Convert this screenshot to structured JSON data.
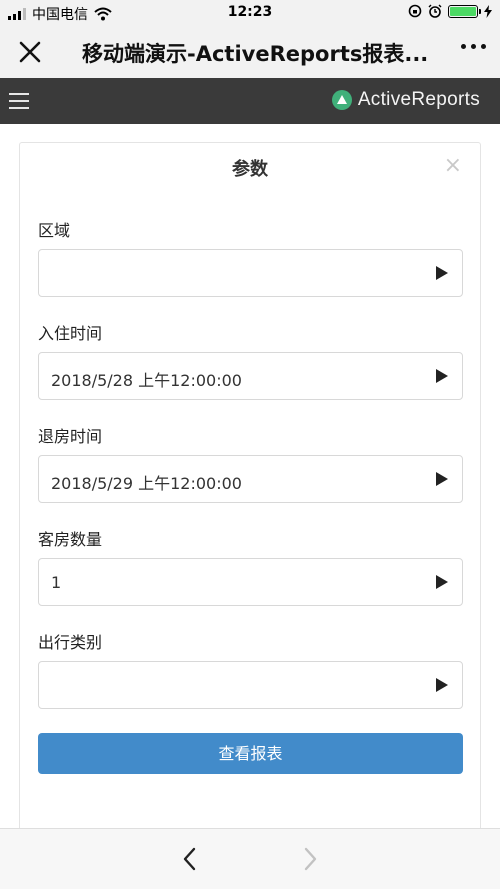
{
  "status_bar": {
    "carrier": "中国电信",
    "time": "12:23"
  },
  "title_bar": {
    "title": "移动端演示-ActiveReports报表..."
  },
  "app_header": {
    "brand": "ActiveReports"
  },
  "dialog": {
    "title": "参数",
    "fields": [
      {
        "label": "区域",
        "value": ""
      },
      {
        "label": "入住时间",
        "value": "2018/5/28 上午12:00:00"
      },
      {
        "label": "退房时间",
        "value": "2018/5/29 上午12:00:00"
      },
      {
        "label": "客房数量",
        "value": "1"
      },
      {
        "label": "出行类别",
        "value": ""
      }
    ],
    "submit_label": "查看报表"
  },
  "icons": {
    "close": "close-icon",
    "more": "more-icon",
    "menu": "hamburger-menu-icon",
    "logo": "activereports-logo-icon",
    "dropdown": "play-arrow-icon",
    "back": "chevron-left-icon",
    "forward": "chevron-right-icon"
  },
  "colors": {
    "header_bg": "#3a3a3a",
    "button_bg": "#428bca",
    "logo": "#40b07a",
    "battery": "#4cd964"
  }
}
